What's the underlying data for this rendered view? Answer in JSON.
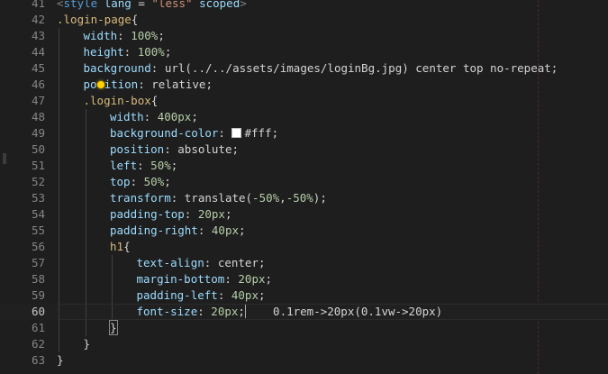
{
  "editor": {
    "guide_columns": [
      1,
      2,
      3
    ],
    "current_line": "60",
    "lines": [
      {
        "num": "41",
        "indent": 0,
        "tokens": [
          {
            "t": "punc",
            "v": "<"
          },
          {
            "t": "tag",
            "v": "style"
          },
          {
            "t": "text",
            "v": " "
          },
          {
            "t": "attr",
            "v": "lang"
          },
          {
            "t": "text",
            "v": " = "
          },
          {
            "t": "str",
            "v": "\"less\""
          },
          {
            "t": "text",
            "v": " "
          },
          {
            "t": "attr",
            "v": "scoped"
          },
          {
            "t": "punc",
            "v": ">"
          }
        ]
      },
      {
        "num": "42",
        "indent": 0,
        "tokens": [
          {
            "t": "sel",
            "v": ".login-page"
          },
          {
            "t": "brace",
            "v": "{"
          }
        ]
      },
      {
        "num": "43",
        "indent": 1,
        "tokens": [
          {
            "t": "prop",
            "v": "width"
          },
          {
            "t": "text",
            "v": ": "
          },
          {
            "t": "num",
            "v": "100%"
          },
          {
            "t": "text",
            "v": ";"
          }
        ]
      },
      {
        "num": "44",
        "indent": 1,
        "tokens": [
          {
            "t": "prop",
            "v": "height"
          },
          {
            "t": "text",
            "v": ": "
          },
          {
            "t": "num",
            "v": "100%"
          },
          {
            "t": "text",
            "v": ";"
          }
        ]
      },
      {
        "num": "45",
        "indent": 1,
        "tokens": [
          {
            "t": "prop",
            "v": "background"
          },
          {
            "t": "text",
            "v": ": url(../../assets/images/loginBg.jpg) center top no-repeat;"
          }
        ]
      },
      {
        "num": "46",
        "indent": 1,
        "tokens": [
          {
            "t": "prop",
            "v": "po"
          },
          {
            "t": "dot",
            "v": ""
          },
          {
            "t": "prop",
            "v": "ition"
          },
          {
            "t": "text",
            "v": ": relative;"
          }
        ]
      },
      {
        "num": "47",
        "indent": 1,
        "tokens": [
          {
            "t": "sel",
            "v": ".login-box"
          },
          {
            "t": "brace",
            "v": "{"
          }
        ]
      },
      {
        "num": "48",
        "indent": 2,
        "tokens": [
          {
            "t": "prop",
            "v": "width"
          },
          {
            "t": "text",
            "v": ": "
          },
          {
            "t": "num",
            "v": "400px"
          },
          {
            "t": "text",
            "v": ";"
          }
        ]
      },
      {
        "num": "49",
        "indent": 2,
        "tokens": [
          {
            "t": "prop",
            "v": "background-color"
          },
          {
            "t": "text",
            "v": ": "
          },
          {
            "t": "swatch",
            "v": "",
            "color": "#ffffff"
          },
          {
            "t": "text",
            "v": "#fff;"
          }
        ]
      },
      {
        "num": "50",
        "indent": 2,
        "tokens": [
          {
            "t": "prop",
            "v": "position"
          },
          {
            "t": "text",
            "v": ": absolute;"
          }
        ]
      },
      {
        "num": "51",
        "indent": 2,
        "tokens": [
          {
            "t": "prop",
            "v": "left"
          },
          {
            "t": "text",
            "v": ": "
          },
          {
            "t": "num",
            "v": "50%"
          },
          {
            "t": "text",
            "v": ";"
          }
        ]
      },
      {
        "num": "52",
        "indent": 2,
        "tokens": [
          {
            "t": "prop",
            "v": "top"
          },
          {
            "t": "text",
            "v": ": "
          },
          {
            "t": "num",
            "v": "50%"
          },
          {
            "t": "text",
            "v": ";"
          }
        ]
      },
      {
        "num": "53",
        "indent": 2,
        "tokens": [
          {
            "t": "prop",
            "v": "transform"
          },
          {
            "t": "text",
            "v": ": translate("
          },
          {
            "t": "num",
            "v": "-50%"
          },
          {
            "t": "text",
            "v": ","
          },
          {
            "t": "num",
            "v": "-50%"
          },
          {
            "t": "text",
            "v": ");"
          }
        ]
      },
      {
        "num": "54",
        "indent": 2,
        "tokens": [
          {
            "t": "prop",
            "v": "padding-top"
          },
          {
            "t": "text",
            "v": ": "
          },
          {
            "t": "num",
            "v": "20px"
          },
          {
            "t": "text",
            "v": ";"
          }
        ]
      },
      {
        "num": "55",
        "indent": 2,
        "tokens": [
          {
            "t": "prop",
            "v": "padding-right"
          },
          {
            "t": "text",
            "v": ": "
          },
          {
            "t": "num",
            "v": "40px"
          },
          {
            "t": "text",
            "v": ";"
          }
        ]
      },
      {
        "num": "56",
        "indent": 2,
        "tokens": [
          {
            "t": "sel",
            "v": "h1"
          },
          {
            "t": "brace",
            "v": "{"
          }
        ]
      },
      {
        "num": "57",
        "indent": 3,
        "tokens": [
          {
            "t": "prop",
            "v": "text-align"
          },
          {
            "t": "text",
            "v": ": center;"
          }
        ]
      },
      {
        "num": "58",
        "indent": 3,
        "tokens": [
          {
            "t": "prop",
            "v": "margin-bottom"
          },
          {
            "t": "text",
            "v": ": "
          },
          {
            "t": "num",
            "v": "20px"
          },
          {
            "t": "text",
            "v": ";"
          }
        ]
      },
      {
        "num": "59",
        "indent": 3,
        "tokens": [
          {
            "t": "prop",
            "v": "padding-left"
          },
          {
            "t": "text",
            "v": ": "
          },
          {
            "t": "num",
            "v": "40px"
          },
          {
            "t": "text",
            "v": ";"
          }
        ]
      },
      {
        "num": "60",
        "indent": 3,
        "tokens": [
          {
            "t": "prop",
            "v": "font-size"
          },
          {
            "t": "text",
            "v": ": "
          },
          {
            "t": "num",
            "v": "20px"
          },
          {
            "t": "text",
            "v": ";"
          },
          {
            "t": "cursor",
            "v": ""
          },
          {
            "t": "hint",
            "v": "    0.1rem->20px(0.1vw->20px)"
          }
        ]
      },
      {
        "num": "61",
        "indent": 2,
        "tokens": [
          {
            "t": "brace_match",
            "v": "}"
          }
        ]
      },
      {
        "num": "62",
        "indent": 1,
        "tokens": [
          {
            "t": "brace",
            "v": "}"
          }
        ]
      },
      {
        "num": "63",
        "indent": 0,
        "tokens": [
          {
            "t": "brace",
            "v": "}"
          }
        ]
      }
    ]
  }
}
